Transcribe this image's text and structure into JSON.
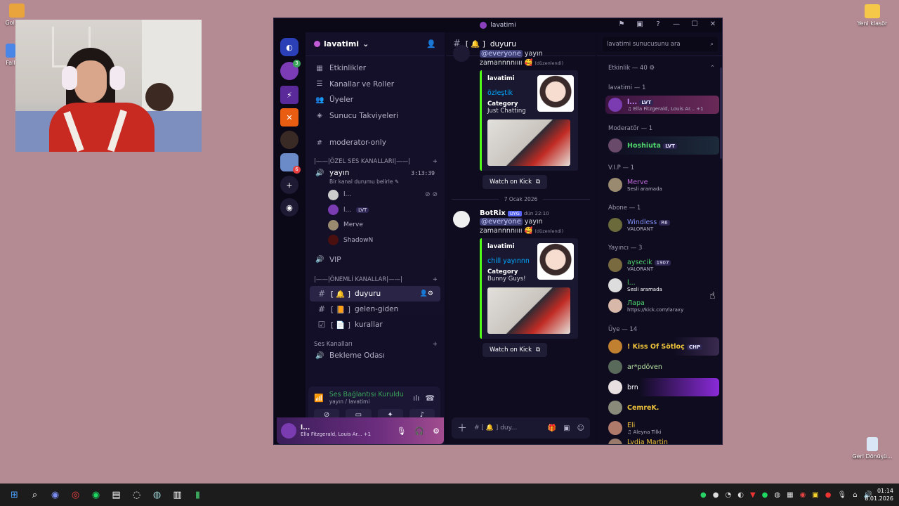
{
  "desktop": {
    "left_icons": [
      {
        "label": "Gol Your"
      },
      {
        "label": "Fall"
      }
    ],
    "folder_label": "Yeni klasör",
    "recycle_label": "Geri Dönüşü..."
  },
  "window": {
    "title": "lavatimi"
  },
  "server": {
    "name": "lavatimi",
    "nav": [
      {
        "label": "Etkinlikler",
        "icon": "calendar-icon"
      },
      {
        "label": "Kanallar ve Roller",
        "icon": "channels-roles-icon"
      },
      {
        "label": "Üyeler",
        "icon": "members-icon"
      },
      {
        "label": "Sunucu Takviyeleri",
        "icon": "boost-icon"
      }
    ],
    "moderator_channel": "moderator-only",
    "voice_category": "|——|ÖZEL SES KANALLARI|——|",
    "voice_channel": {
      "name": "yayın",
      "status": "Bir kanal durumu belirle",
      "timer": "3:13:39"
    },
    "voice_users": [
      {
        "name": "l...",
        "tag": ""
      },
      {
        "name": "l...",
        "tag": "LVT"
      },
      {
        "name": "Merve",
        "tag": ""
      },
      {
        "name": "ShadowN",
        "tag": ""
      }
    ],
    "vip_channel": "VIP",
    "important_category": "|——|ÖNEMLİ KANALLAR|——|",
    "text_channels": [
      {
        "name": "duyuru",
        "prefix": "[ 🔔 ]"
      },
      {
        "name": "gelen-giden",
        "prefix": "[ 📙 ]"
      },
      {
        "name": "kurallar",
        "prefix": "[ 📄 ]"
      }
    ],
    "sound_category": "Ses Kanalları",
    "partial_channel": "Bekleme Odası"
  },
  "voice_panel": {
    "title": "Ses Bağlantısı Kuruldu",
    "sub": "yayın / lavatimi"
  },
  "user_panel": {
    "name": "l...",
    "status": "Ella Fitzgerald, Louis Ar...",
    "extra": "+1"
  },
  "chat": {
    "channel_prefix": "[ 🔔 ]",
    "channel_name": "duyuru",
    "composer_placeholder": "# [ 🔔 ] duy...",
    "msg1": {
      "mention": "@everyone",
      "text1": "yayın",
      "text2": "zamannnnıııı 🥰",
      "edited": "(düzenlendi)",
      "embed": {
        "author": "lavatimi",
        "title": "özleştik",
        "cat_label": "Category",
        "cat_val": "Just Chatting"
      },
      "watch": "Watch on Kick"
    },
    "date_divider": "7 Ocak 2026",
    "msg2": {
      "author": "BotRix",
      "badge": "UYG",
      "time": "dün 22:10",
      "mention": "@everyone",
      "text1": "yayın",
      "text2": "zamannnnıııı 🥰",
      "edited": "(düzenlendi)",
      "embed": {
        "author": "lavatimi",
        "title": "chill yayınnn",
        "cat_label": "Category",
        "cat_val": "Bunny Guys!"
      },
      "watch": "Watch on Kick"
    }
  },
  "members": {
    "search_placeholder": "lavatimi sunucusunu ara",
    "activity_header": "Etkinlik — 40 ⚙",
    "groups": [
      {
        "label": "lavatimi — 1"
      },
      {
        "label": "Moderatör — 1"
      },
      {
        "label": "V.I.P — 1"
      },
      {
        "label": "Abone — 1"
      },
      {
        "label": "Yayıncı — 3"
      },
      {
        "label": "Üye — 14"
      }
    ],
    "list": [
      {
        "name": "l...",
        "tag": "LVT",
        "status": "♫ Ella Fitzgerald, Louis Ar...  +1",
        "color": "#c58bff"
      },
      {
        "name": "Hoshiuta",
        "tag": "LVT",
        "status": "",
        "color": "#4fd26b"
      },
      {
        "name": "Merve",
        "tag": "",
        "status": "Sesli aramada",
        "color": "#c06ad7"
      },
      {
        "name": "Windless",
        "tag": "R6",
        "status": "VALORANT",
        "color": "#7e8df2"
      },
      {
        "name": "aysecik",
        "tag": "1907",
        "status": "VALORANT",
        "color": "#4fd26b"
      },
      {
        "name": "l...",
        "tag": "",
        "status": "Sesli aramada",
        "color": "#4fd26b"
      },
      {
        "name": "Лара",
        "tag": "",
        "status": "https://kick.com/laraxy",
        "color": "#4fd26b"
      },
      {
        "name": "! Kiss Of Sötloç",
        "tag": "CHP",
        "status": "",
        "color": "#f0c43a"
      },
      {
        "name": "ar*pdöven",
        "tag": "",
        "status": "",
        "color": "#b7e4a1"
      },
      {
        "name": "brn",
        "tag": "",
        "status": "",
        "color": "#ffffff"
      },
      {
        "name": "CemreK.",
        "tag": "",
        "status": "",
        "color": "#f0c43a"
      },
      {
        "name": "Eli",
        "tag": "",
        "status": "♫ Aleyna Tilki",
        "color": "#f0c43a"
      },
      {
        "name": "Lydia Martin",
        "tag": "",
        "status": "",
        "color": "#f0c43a"
      }
    ]
  },
  "taskbar": {
    "time": "01:14",
    "date": "8.01.2026"
  }
}
